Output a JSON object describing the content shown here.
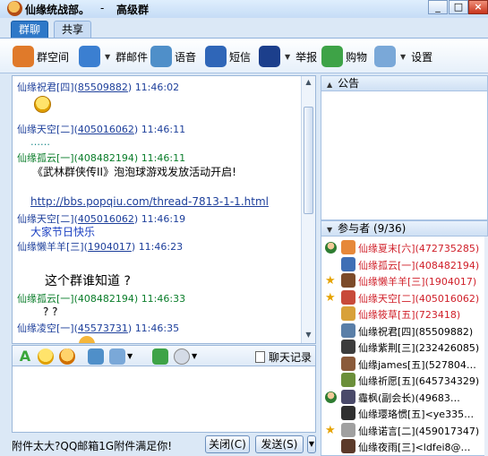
{
  "window": {
    "title": "仙缘统战部。",
    "separator": "-",
    "subtitle": "高级群",
    "controls": [
      "_",
      "□",
      "×"
    ]
  },
  "tabs": [
    {
      "label": "群聊",
      "active": true
    },
    {
      "label": "共享",
      "active": false
    }
  ],
  "toolbar": [
    {
      "label": "群空间",
      "icon": "group-space-icon",
      "color": "#e07a2a"
    },
    {
      "label": "群邮件",
      "icon": "mail-icon",
      "color": "#3b7fd1"
    },
    {
      "label": "语音",
      "icon": "voice-icon",
      "color": "#4f8fc9"
    },
    {
      "label": "短信",
      "icon": "sms-icon",
      "color": "#2f66b8"
    },
    {
      "label": "举报",
      "icon": "police-icon",
      "color": "#1c3f8c"
    },
    {
      "label": "购物",
      "icon": "shopping-icon",
      "color": "#3ea347"
    },
    {
      "label": "设置",
      "icon": "settings-icon",
      "color": "#7aa8d8"
    }
  ],
  "messages": [
    {
      "sender": "仙缘祝君[四]",
      "qq": "85509882",
      "time": "11:46:02",
      "color": "blue",
      "body": ""
    },
    {
      "sender": "仙缘天空[二]",
      "qq": "405016062",
      "time": "11:46:11",
      "color": "blue",
      "body": "……"
    },
    {
      "sender": "仙缘孤云[一]",
      "qq": "408482194",
      "time": "11:46:11",
      "color": "green",
      "body": "《武林群侠传II》泡泡球游戏发放活动开启!"
    },
    {
      "link": "http://bbs.popqiu.com/thread-7813-1-1.html"
    },
    {
      "sender": "仙缘天空[二]",
      "qq": "405016062",
      "time": "11:46:19",
      "color": "blue",
      "body": "大家节日快乐"
    },
    {
      "sender": "仙缘懒羊羊[三]",
      "qq": "1904017",
      "time": "11:46:23",
      "color": "blue",
      "body": "这个群谁知道 ?"
    },
    {
      "sender": "仙缘孤云[一]",
      "qq": "408482194",
      "time": "11:46:33",
      "color": "green",
      "body": "? ?"
    },
    {
      "sender": "仙缘凌空[一]",
      "qq": "45573731",
      "time": "11:46:35",
      "color": "blue",
      "body": ""
    }
  ],
  "input_toolbar": {
    "history_label": "聊天记录"
  },
  "bottom": {
    "tip": "附件太大?QQ邮箱1G附件满足你!",
    "close_label": "关闭(C)",
    "send_label": "发送(S)"
  },
  "notice": {
    "title": "公告"
  },
  "members": {
    "title": "参与者 (9/36)",
    "list": [
      {
        "name": "仙缘夏末[六]",
        "qq": "(472735285)",
        "red": true,
        "role": "owner"
      },
      {
        "name": "仙缘孤云[一]",
        "qq": "(408482194)",
        "red": true,
        "role": ""
      },
      {
        "name": "仙缘懒羊羊[三]",
        "qq": "(1904017)",
        "red": true,
        "role": "admin"
      },
      {
        "name": "仙缘天空[二]",
        "qq": "(405016062)",
        "red": true,
        "role": "admin"
      },
      {
        "name": "仙缘筱草[五]",
        "qq": "(723418)",
        "red": true,
        "role": ""
      },
      {
        "name": "仙缘祝君[四]",
        "qq": "(85509882)",
        "red": false,
        "role": ""
      },
      {
        "name": "仙缘紫荆[三]",
        "qq": "(232426085)",
        "red": false,
        "role": ""
      },
      {
        "name": "仙缘james[五]",
        "qq": "(527804…",
        "red": false,
        "role": ""
      },
      {
        "name": "仙缘祈愿[五]",
        "qq": "(645734329)",
        "red": false,
        "role": ""
      },
      {
        "name": "霾枫(副会长)",
        "qq": "(49683…",
        "red": false,
        "role": "owner"
      },
      {
        "name": "仙缘璎珞惯[五]",
        "qq": "<ye335…",
        "red": false,
        "role": ""
      },
      {
        "name": "仙缘诺言[二]",
        "qq": "(459017347)",
        "red": false,
        "role": "admin"
      },
      {
        "name": "仙缘夜雨[三]",
        "qq": "<ldfei8@…",
        "red": false,
        "role": ""
      }
    ]
  }
}
